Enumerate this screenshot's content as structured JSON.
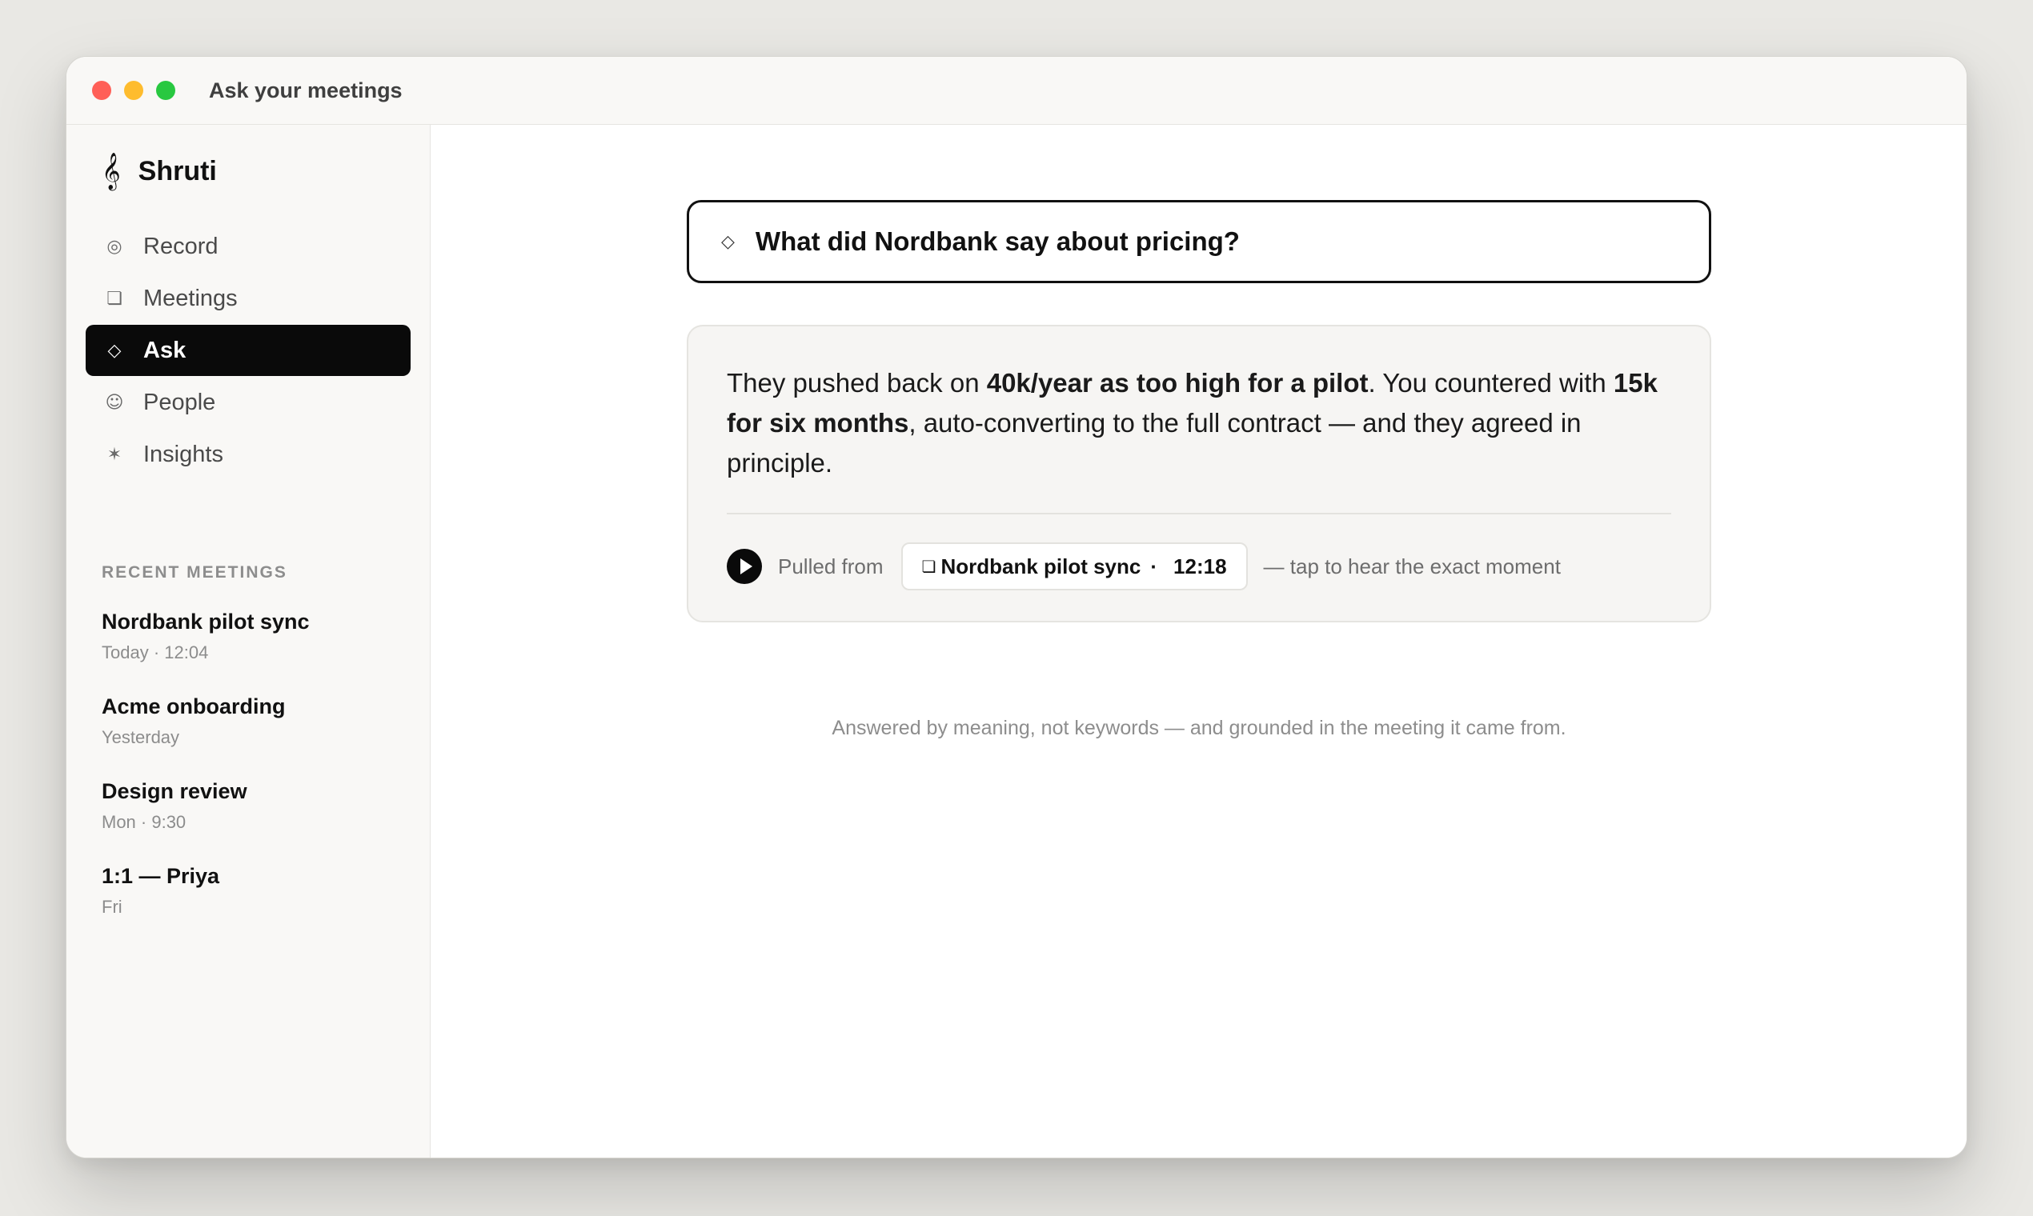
{
  "window": {
    "title": "Ask your meetings"
  },
  "sidebar": {
    "brand": {
      "icon": "treble-clef-icon",
      "glyph": "𝄞",
      "name": "Shruti"
    },
    "nav": [
      {
        "label": "Record",
        "icon": "record-icon",
        "glyph": "◎",
        "active": false
      },
      {
        "label": "Meetings",
        "icon": "meetings-icon",
        "glyph": "❏",
        "active": false
      },
      {
        "label": "Ask",
        "icon": "ask-diamond-icon",
        "glyph": "◇",
        "active": true
      },
      {
        "label": "People",
        "icon": "people-smiley-icon",
        "glyph": "☺",
        "active": false
      },
      {
        "label": "Insights",
        "icon": "insights-star-icon",
        "glyph": "✶",
        "active": false
      }
    ],
    "recent_label": "RECENT MEETINGS",
    "recent": [
      {
        "title": "Nordbank pilot sync",
        "meta": "Today · 12:04"
      },
      {
        "title": "Acme onboarding",
        "meta": "Yesterday"
      },
      {
        "title": "Design review",
        "meta": "Mon · 9:30"
      },
      {
        "title": "1:1 — Priya",
        "meta": "Fri"
      }
    ]
  },
  "main": {
    "question": {
      "icon": "diamond-icon",
      "glyph": "◇",
      "value": "What did Nordbank say about pricing?"
    },
    "answer": {
      "parts": [
        {
          "text": "They pushed back on ",
          "bold": false
        },
        {
          "text": "40k/year as too high for a pilot",
          "bold": true
        },
        {
          "text": ". You countered with ",
          "bold": false
        },
        {
          "text": "15k for six months",
          "bold": true
        },
        {
          "text": ", auto-converting to the full contract — and they agreed in principle.",
          "bold": false
        }
      ],
      "pulled_from": "Pulled from",
      "source": {
        "icon": "meeting-doc-icon",
        "glyph": "❏",
        "title": "Nordbank pilot sync",
        "separator": "·",
        "timestamp": "12:18"
      },
      "tap_hint": "— tap to hear the exact moment"
    },
    "footnote": "Answered by meaning, not keywords — and grounded in the meeting it came from."
  },
  "colors": {
    "background": "#e9e8e4",
    "sidebar": "#f9f8f6",
    "accent": "#0a0a0a",
    "answer_card": "#f6f5f3",
    "muted_text": "#8d8d8d"
  }
}
